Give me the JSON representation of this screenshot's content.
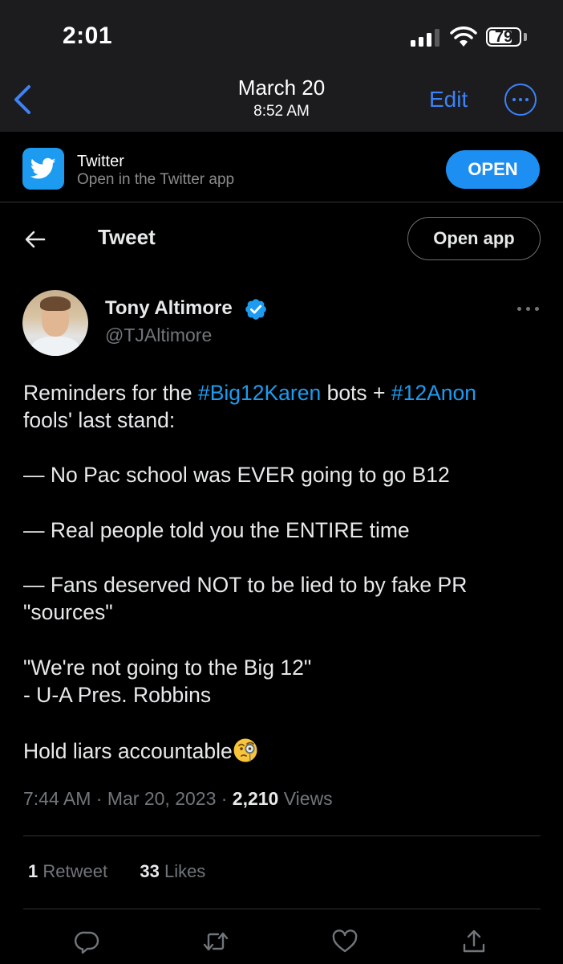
{
  "status_bar": {
    "time": "2:01",
    "battery": "79",
    "battery_level": 0.79
  },
  "nav": {
    "date": "March 20",
    "time": "8:52 AM",
    "edit": "Edit"
  },
  "banner": {
    "title": "Twitter",
    "subtitle": "Open in the Twitter app",
    "open_button": "OPEN"
  },
  "header": {
    "title": "Tweet",
    "open_app": "Open app"
  },
  "author": {
    "name": "Tony Altimore",
    "handle": "@TJAltimore"
  },
  "tweet": {
    "l1_a": "Reminders for the ",
    "l1_tag1": "#Big12Karen",
    "l1_b": " bots + ",
    "l1_tag2": "#12Anon",
    "l2": "fools' last stand:",
    "l3": "— No Pac school was EVER going to go B12",
    "l4": "— Real people told you the ENTIRE time",
    "l5": "— Fans deserved NOT to be lied to by fake PR",
    "l6": "\"sources\"",
    "l7": "\"We're not going to the Big 12\"",
    "l8": "- U-A Pres. Robbins",
    "l9": "Hold liars accountable"
  },
  "meta": {
    "timestamp": "7:44 AM · Mar 20, 2023 · ",
    "views_count": "2,210",
    "views_label": " Views"
  },
  "stats": {
    "retweets_count": "1",
    "retweets_label": "Retweet",
    "likes_count": "33",
    "likes_label": "Likes"
  },
  "icons": [
    "reply-icon",
    "retweet-icon",
    "like-icon",
    "share-icon"
  ],
  "colors": {
    "accent": "#1d9bf0",
    "ios_blue": "#3d82f6",
    "background": "#000000"
  }
}
